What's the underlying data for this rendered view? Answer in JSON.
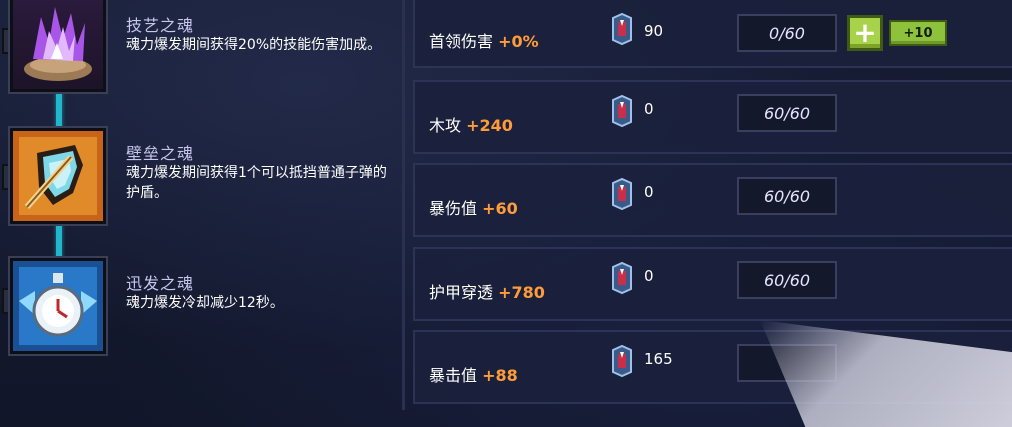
{
  "souls": [
    {
      "name": "技艺之魂",
      "desc": "魂力爆发期间获得20%的技能伤害加成。",
      "icon": "purple-flame-icon"
    },
    {
      "name": "壁垒之魂",
      "desc": "魂力爆发期间获得1个可以抵挡普通子弹的护盾。",
      "icon": "shield-icon"
    },
    {
      "name": "迅发之魂",
      "desc": "魂力爆发冷却减少12秒。",
      "icon": "stopwatch-icon"
    }
  ],
  "stats": [
    {
      "label": "首领伤害",
      "bonus": "+0%",
      "count": "90",
      "level": "0/60",
      "plus_label": "+",
      "plus10_label": "+10"
    },
    {
      "label": "木攻",
      "bonus": "+240",
      "count": "0",
      "level": "60/60"
    },
    {
      "label": "暴伤值",
      "bonus": "+60",
      "count": "0",
      "level": "60/60"
    },
    {
      "label": "护甲穿透",
      "bonus": "+780",
      "count": "0",
      "level": "60/60"
    },
    {
      "label": "暴击值",
      "bonus": "+88",
      "count": "165",
      "level": ""
    }
  ],
  "colors": {
    "bonus": "#ff9c3a",
    "chain": "#1fb7c9",
    "button": "#a8d24a"
  }
}
